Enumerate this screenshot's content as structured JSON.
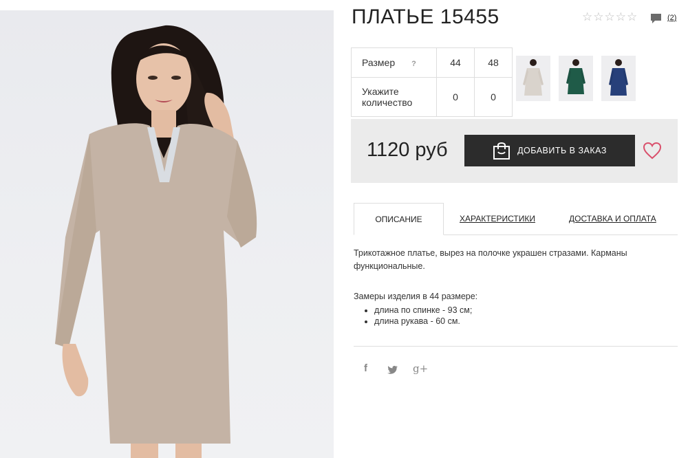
{
  "product": {
    "title": "ПЛАТЬЕ 15455",
    "reviews_count": "(2)",
    "stars_icon": "empty-star-icon"
  },
  "sizes": {
    "size_label": "Размер",
    "help": "?",
    "quantity_label_line1": "Укажите",
    "quantity_label_line2": "количество",
    "columns": [
      {
        "size": "44",
        "qty": "0"
      },
      {
        "size": "48",
        "qty": "0"
      }
    ]
  },
  "thumbnails": [
    {
      "name": "beige-dress",
      "color": "#d9d3cc"
    },
    {
      "name": "green-dress",
      "color": "#1f5b48"
    },
    {
      "name": "navy-dress",
      "color": "#27407a"
    }
  ],
  "purchase": {
    "price": "1120 руб",
    "add_button": "ДОБАВИТЬ В ЗАКАЗ",
    "accent_color": "#d94f6b"
  },
  "tabs": [
    {
      "label": "ОПИСАНИЕ",
      "active": true
    },
    {
      "label": "ХАРАКТЕРИСТИКИ",
      "active": false
    },
    {
      "label": "ДОСТАВКА И ОПЛАТА",
      "active": false
    }
  ],
  "description": {
    "text": "Трикотажное платье, вырез на полочке украшен стразами. Карманы функциональные.",
    "measures_title": "Замеры изделия в 44 размере:",
    "measures": [
      "длина по спинке - 93 см;",
      "длина рукава - 60 см."
    ]
  },
  "social": {
    "facebook": "f",
    "twitter": "twitter-icon",
    "google": "g+"
  }
}
